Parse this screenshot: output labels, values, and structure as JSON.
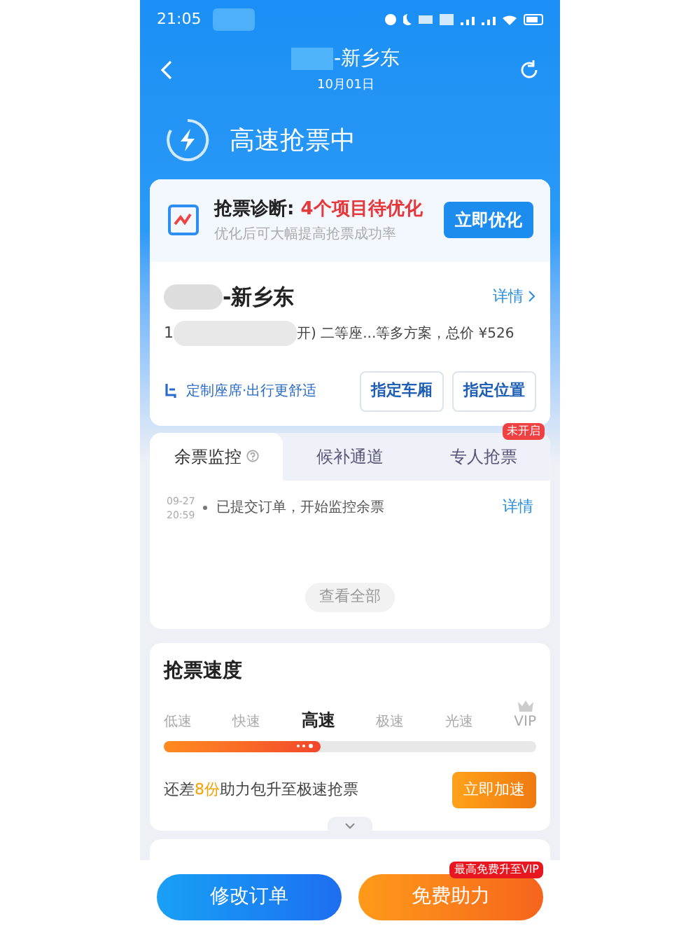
{
  "status_bar": {
    "time": "21:05"
  },
  "header": {
    "title": "-新乡东",
    "date": "10月01日"
  },
  "banner": {
    "title": "高速抢票中"
  },
  "diagnosis": {
    "label": "抢票诊断: ",
    "highlight": "4个项目待优化",
    "subtitle": "优化后可大幅提高抢票成功率",
    "button": "立即优化"
  },
  "trip": {
    "route": "-新乡东",
    "details_link": "详情",
    "prefix": "1",
    "summary": "开) 二等座...等多方案，总价 ¥526"
  },
  "seat": {
    "label": "定制座席·出行更舒适",
    "buttons": [
      "指定车厢",
      "指定位置"
    ]
  },
  "tabs": [
    {
      "label": "余票监控",
      "selected": true,
      "help": true
    },
    {
      "label": "候补通道",
      "selected": false
    },
    {
      "label": "专人抢票",
      "selected": false,
      "badge": "未开启"
    }
  ],
  "log": [
    {
      "date": "09-27",
      "time": "20:59",
      "text": "已提交订单，开始监控余票",
      "link": "详情"
    }
  ],
  "view_all": "查看全部",
  "speed": {
    "title": "抢票速度",
    "levels": [
      {
        "label": "低速",
        "selected": false
      },
      {
        "label": "快速",
        "selected": false
      },
      {
        "label": "高速",
        "selected": true
      },
      {
        "label": "极速",
        "selected": false
      },
      {
        "label": "光速",
        "selected": false
      },
      {
        "label": "VIP",
        "selected": false,
        "crown": true
      }
    ],
    "level": 0.42,
    "hint_before": "还差",
    "hint_count": "8份",
    "hint_after": "助力包升至极速抢票",
    "button": "立即加速"
  },
  "bottom_bar": {
    "modify": "修改订单",
    "assist": "免费助力",
    "assist_badge": "最高免费升至VIP"
  }
}
